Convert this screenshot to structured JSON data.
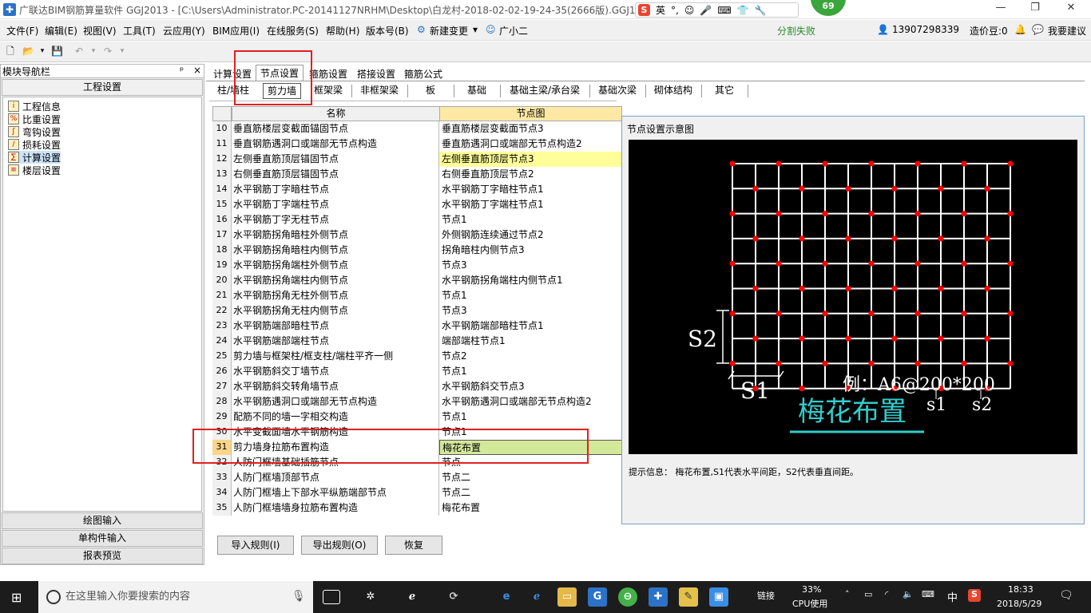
{
  "window": {
    "title": "广联达BIM钢筋算量软件 GGJ2013 - [C:\\Users\\Administrator.PC-20141127NRHM\\Desktop\\白龙村-2018-02-02-19-24-35(2666版).GGJ12]",
    "ime": [
      "S",
      "英",
      "°,",
      "☺",
      "🎤",
      "⌨",
      "👕",
      "🔧"
    ],
    "badge": "69",
    "controls": [
      "—",
      "❐",
      "✕"
    ]
  },
  "menu": {
    "items": [
      "文件(F)",
      "编辑(E)",
      "视图(V)",
      "工具(T)",
      "云应用(Y)",
      "BIM应用(I)",
      "在线服务(S)",
      "帮助(H)",
      "版本号(B)",
      "新建变更",
      "广小二"
    ],
    "status": "分割失败",
    "phone": "13907298339",
    "beans": "造价豆:0",
    "suggest": "我要建议"
  },
  "leftnav": {
    "title": "模块导航栏",
    "pin": "ᵖ",
    "close": "×",
    "section": "工程设置",
    "items": [
      "工程信息",
      "比重设置",
      "弯钩设置",
      "损耗设置",
      "计算设置",
      "楼层设置"
    ],
    "bottom": [
      "绘图输入",
      "单构件输入",
      "报表预览"
    ]
  },
  "tabs": [
    "计算设置",
    "节点设置",
    "箍筋设置",
    "搭接设置",
    "箍筋公式"
  ],
  "subtabs": [
    "柱/墙柱",
    "剪力墙",
    "框架梁",
    "非框架梁",
    "板",
    "基础",
    "基础主梁/承台梁",
    "基础次梁",
    "砌体结构",
    "其它"
  ],
  "grid": {
    "col_name": "名称",
    "col_val": "节点图",
    "rows": [
      {
        "n": "10",
        "name": "垂直筋楼层变截面锚固节点",
        "val": "垂直筋楼层变截面节点3"
      },
      {
        "n": "11",
        "name": "垂直钢筋遇洞口或端部无节点构造",
        "val": "垂直筋遇洞口或端部无节点构造2"
      },
      {
        "n": "12",
        "name": "左侧垂直筋顶层锚固节点",
        "val": "左侧垂直筋顶层节点3"
      },
      {
        "n": "13",
        "name": "右侧垂直筋顶层锚固节点",
        "val": "右侧垂直筋顶层节点2"
      },
      {
        "n": "14",
        "name": "水平钢筋丁字暗柱节点",
        "val": "水平钢筋丁字暗柱节点1"
      },
      {
        "n": "15",
        "name": "水平钢筋丁字端柱节点",
        "val": "水平钢筋丁字端柱节点1"
      },
      {
        "n": "16",
        "name": "水平钢筋丁字无柱节点",
        "val": "节点1"
      },
      {
        "n": "17",
        "name": "水平钢筋拐角暗柱外侧节点",
        "val": "外侧钢筋连续通过节点2"
      },
      {
        "n": "18",
        "name": "水平钢筋拐角暗柱内侧节点",
        "val": "拐角暗柱内侧节点3"
      },
      {
        "n": "19",
        "name": "水平钢筋拐角端柱外侧节点",
        "val": "节点3"
      },
      {
        "n": "20",
        "name": "水平钢筋拐角端柱内侧节点",
        "val": "水平钢筋拐角端柱内侧节点1"
      },
      {
        "n": "21",
        "name": "水平钢筋拐角无柱外侧节点",
        "val": "节点1"
      },
      {
        "n": "22",
        "name": "水平钢筋拐角无柱内侧节点",
        "val": "节点3"
      },
      {
        "n": "23",
        "name": "水平钢筋端部暗柱节点",
        "val": "水平钢筋端部暗柱节点1"
      },
      {
        "n": "24",
        "name": "水平钢筋端部端柱节点",
        "val": "端部端柱节点1"
      },
      {
        "n": "25",
        "name": "剪力墙与框架柱/框支柱/端柱平齐一侧",
        "val": "节点2"
      },
      {
        "n": "26",
        "name": "水平钢筋斜交丁墙节点",
        "val": "节点1"
      },
      {
        "n": "27",
        "name": "水平钢筋斜交转角墙节点",
        "val": "水平钢筋斜交节点3"
      },
      {
        "n": "28",
        "name": "水平钢筋遇洞口或端部无节点构造",
        "val": "水平钢筋遇洞口或端部无节点构造2"
      },
      {
        "n": "29",
        "name": "配筋不同的墙一字相交构造",
        "val": "节点1"
      },
      {
        "n": "30",
        "name": "水平变截面墙水平钢筋构造",
        "val": "节点1"
      },
      {
        "n": "31",
        "name": "剪力墙身拉筋布置构造",
        "val": "梅花布置"
      },
      {
        "n": "32",
        "name": "人防门框墙基础插筋节点",
        "val": "节点"
      },
      {
        "n": "33",
        "name": "人防门框墙顶部节点",
        "val": "节点二"
      },
      {
        "n": "34",
        "name": "人防门框墙上下部水平纵筋端部节点",
        "val": "节点二"
      },
      {
        "n": "35",
        "name": "人防门框墙墙身拉筋布置构造",
        "val": "梅花布置"
      }
    ]
  },
  "diagram": {
    "title": "节点设置示意图",
    "label_s2": "S2",
    "label_s1": "S1",
    "example": "例：A6@200*200",
    "caption": "梅花布置",
    "sub_s1": "s1",
    "sub_s2": "s2",
    "hint": "提示信息： 梅花布置,S1代表水平间距，S2代表垂直间距。"
  },
  "buttons": [
    "导入规则(I)",
    "导出规则(O)",
    "恢复"
  ],
  "taskbar": {
    "search_placeholder": "在这里输入你要搜索的内容",
    "link": "链接",
    "cpu": "33%",
    "cpu_label": "CPU使用",
    "lang": "中",
    "time": "18:33",
    "date": "2018/5/29"
  },
  "colors": {
    "highlight_row": "#ffff99",
    "selected_row": "#d4e89a",
    "grid_line": "#ffffff",
    "dot": "#ff0000",
    "caption": "#33cccc"
  }
}
